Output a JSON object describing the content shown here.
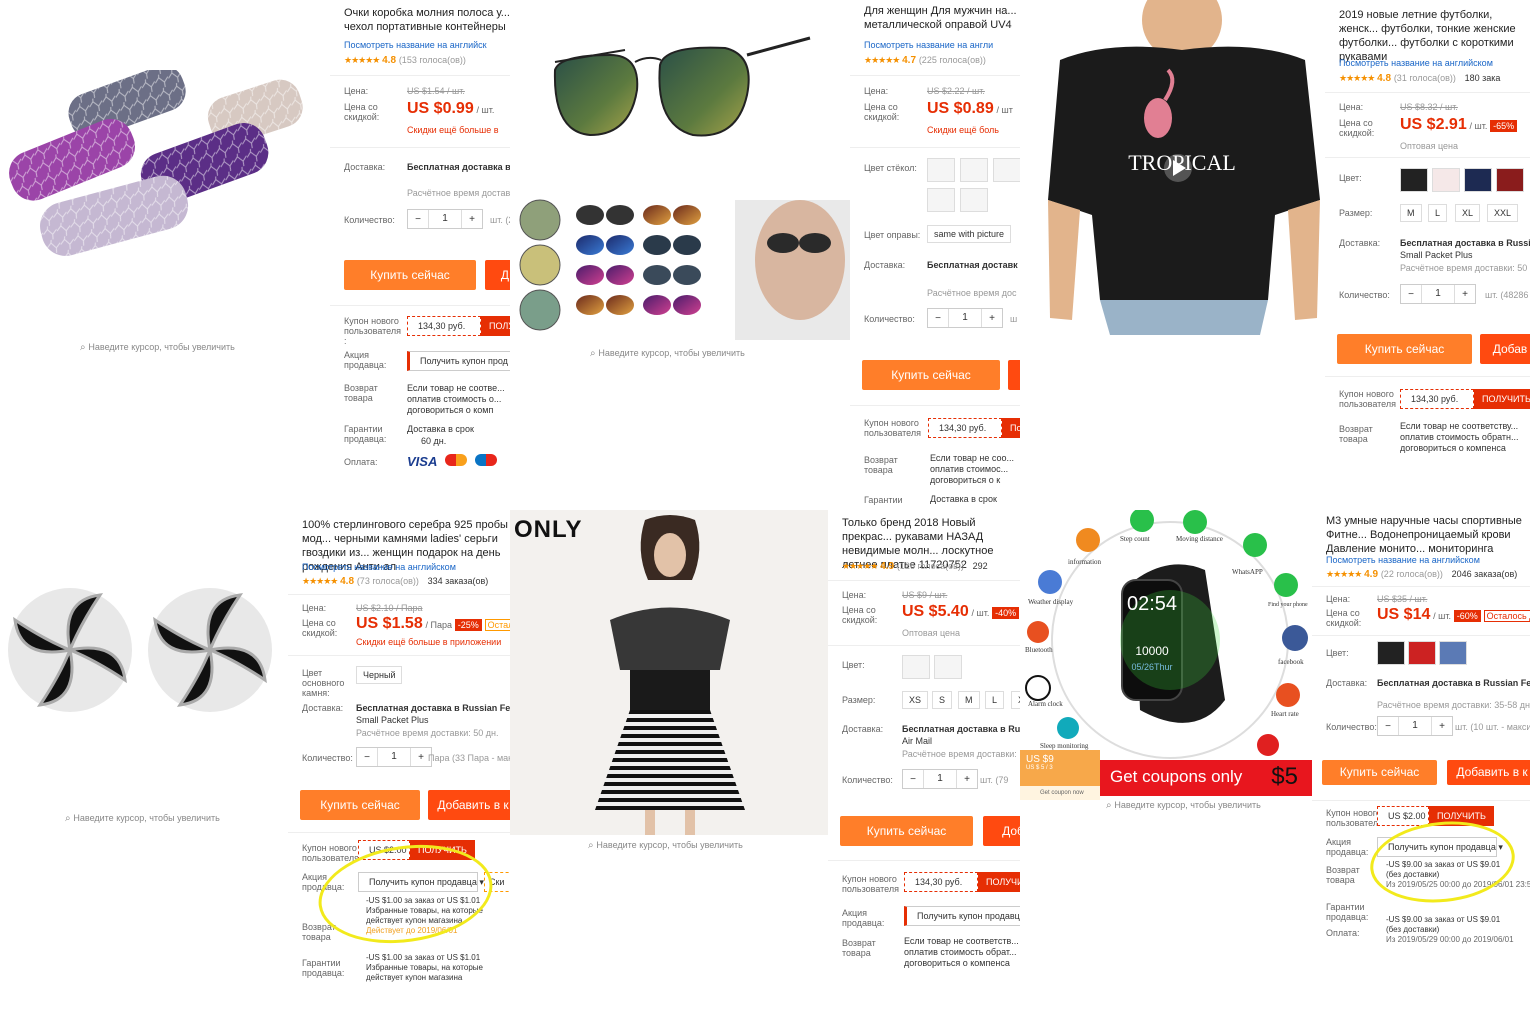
{
  "hint": "Наведите курсор, чтобы увеличить",
  "colors": {
    "accent": "#ff7e29",
    "price": "#e62e04",
    "link": "#1a66c7",
    "highlight": "#f2ea1c"
  },
  "p1": {
    "title": "Очки коробка молния полоса у... чехол портативные контейнеры",
    "translate": "Посмотреть название на английск",
    "stars": "★★★★★",
    "rating": "4.8",
    "reviews": "(153 голоса(ов))",
    "price_lbl": "Цена:",
    "old_price": "US $1.54 / шт.",
    "disc_lbl": "Цена со скидкой:",
    "price": "US $0.99",
    "unit": "/ шт.",
    "app_disc": "Скидки ещё больше в",
    "delivery_lbl": "Доставка:",
    "delivery": "Бесплатная доставка в",
    "delivery_time": "Расчётное время доставк",
    "qty_lbl": "Количество:",
    "qty": "1",
    "qty_unit": "шт. (2",
    "buy": "Купить сейчас",
    "add": "Д",
    "coupon_lbl": "Купон нового пользователя :",
    "coupon": "134,30 руб.",
    "coupon_get": "ПОЛУ",
    "promo_lbl": "Акция продавца:",
    "promo": "Получить купон прод",
    "return_lbl": "Возврат товара",
    "return": "Если товар не соотве... оплатив стоимость о... договориться о комп",
    "guarantee_lbl": "Гарантии продавца:",
    "guarantee": "Доставка в срок",
    "guarantee2": "60 дн.",
    "pay_lbl": "Оплата:",
    "pay_visa": "VISA"
  },
  "p2": {
    "title": "Для женщин Для мужчин на... металлической оправой UV4",
    "translate": "Посмотреть название на англи",
    "stars": "★★★★★",
    "rating": "4.7",
    "reviews": "(225 голоса(ов))",
    "price_lbl": "Цена:",
    "old_price": "US $2.22 / шт.",
    "disc_lbl": "Цена со скидкой:",
    "price": "US $0.89",
    "unit": "/ шт",
    "app_disc": "Скидки ещё боль",
    "lens_lbl": "Цвет стёкол:",
    "frame_lbl": "Цвет оправы:",
    "frame": "same with picture",
    "delivery_lbl": "Доставка:",
    "delivery": "Бесплатная доставк",
    "delivery_time": "Расчётное время дос",
    "qty_lbl": "Количество:",
    "qty": "1",
    "qty_unit": "ш",
    "buy": "Купить сейчас",
    "coupon_lbl": "Купон нового пользователя",
    "coupon": "134,30 руб.",
    "coupon_get": "По",
    "return_lbl": "Возврат товара",
    "return": "Если товар не соо... оплатив стоимос... договориться о к",
    "guarantee_lbl": "Гарантии",
    "guarantee": "Доставка в срок"
  },
  "p3": {
    "title": "2019 новые летние футболки, женск... футболки, тонкие женские футболки... футболки с короткими рукавами",
    "translate": "Посмотреть название на английском",
    "stars": "★★★★★",
    "rating": "4.8",
    "reviews": "(31 голоса(ов))",
    "orders": "180 зака",
    "price_lbl": "Цена:",
    "old_price": "US $8.32 / шт.",
    "disc_lbl": "Цена со скидкой:",
    "price": "US $2.91",
    "unit": "/ шт.",
    "disc": "-65%",
    "wholesale": "Оптовая цена",
    "color_lbl": "Цвет:",
    "size_lbl": "Размер:",
    "sizes": [
      "M",
      "L",
      "XL",
      "XXL"
    ],
    "delivery_lbl": "Доставка:",
    "delivery": "Бесплатная доставка в Russia",
    "delivery2": "Small Packet Plus",
    "delivery_time": "Расчётное время доставки: 50",
    "qty_lbl": "Количество:",
    "qty": "1",
    "qty_unit": "шт. (48286 и",
    "buy": "Купить сейчас",
    "add": "Добав",
    "coupon_lbl": "Купон нового пользователя",
    "coupon": "134,30 руб.",
    "coupon_get": "ПОЛУЧИТЬ",
    "return_lbl": "Возврат товара",
    "return": "Если товар не соответству... оплатив стоимость обратн... договориться о компенса",
    "shirt_text": "TROPICAL"
  },
  "p4": {
    "title": "100% стерлингового серебра 925 пробы мод... черными камнями ladies' серьги гвоздики из... женщин подарок на день рождения Анти-ал",
    "translate": "Посмотреть название на английском",
    "stars": "★★★★★",
    "rating": "4.8",
    "reviews": "(73 голоса(ов))",
    "orders": "334 заказа(ов)",
    "price_lbl": "Цена:",
    "old_price": "US $2.10 / Пара",
    "disc_lbl": "Цена со скидкой:",
    "price": "US $1.58",
    "unit": "/ Пара",
    "disc": "-25%",
    "left": "Остал",
    "app_disc": "Скидки ещё больше в приложении",
    "stone_lbl": "Цвет основного камня:",
    "stone": "Черный",
    "delivery_lbl": "Доставка:",
    "delivery": "Бесплатная доставка в Russian Federa",
    "delivery2": "Small Packet Plus",
    "delivery_time": "Расчётное время доставки: 50 дн.",
    "qty_lbl": "Количество:",
    "qty": "1",
    "qty_unit": "Пара (33 Пара - макс",
    "buy": "Купить сейчас",
    "add": "Добавить в к",
    "coupon_lbl": "Купон нового пользователя",
    "coupon": "US $2.00",
    "coupon_get": "ПОЛУЧИТЬ",
    "promo_lbl": "Акция продавца:",
    "promo": "Получить купон продавца ▾",
    "promo2": "Ски",
    "offer1": "-US $1.00 за заказ от US $1.01",
    "offer1b": "Избранные товары, на которые",
    "offer1c": "действует купон магазина",
    "offer1d": "Действует до 2019/06/01",
    "return_lbl": "Возврат товара",
    "guarantee_lbl": "Гарантии продавца:",
    "offer2": "-US $1.00 за заказ от US $1.01",
    "offer2b": "Избранные товары, на которые",
    "offer2c": "действует купон магазина"
  },
  "p5": {
    "brand": "ONLY",
    "title": "Только бренд 2018 Новый прекрас... рукавами НАЗАД невидимые молн... лоскутное летнее платье 11720752",
    "stars": "★★★★★",
    "rating": "4.9",
    "reviews": "(126 голоса(ов))",
    "orders": "292",
    "price_lbl": "Цена:",
    "old_price": "US $9 / шт.",
    "disc_lbl": "Цена со скидкой:",
    "price": "US $5.40",
    "unit": "/ шт.",
    "disc": "-40%",
    "wholesale": "Оптовая цена",
    "color_lbl": "Цвет:",
    "size_lbl": "Размер:",
    "sizes": [
      "XS",
      "S",
      "M",
      "L",
      "X"
    ],
    "delivery_lbl": "Доставка:",
    "delivery": "Бесплатная доставка в Rus",
    "delivery2": "Air Mail",
    "delivery_time": "Расчётное время доставки:",
    "qty_lbl": "Количество:",
    "qty": "1",
    "qty_unit": "шт. (79",
    "buy": "Купить сейчас",
    "add": "Доб",
    "coupon_lbl": "Купон нового пользователя",
    "coupon": "134,30 руб.",
    "coupon_get": "ПОЛУЧИ",
    "promo_lbl": "Акция продавца:",
    "promo": "Получить купон продавца",
    "return_lbl": "Возврат товара",
    "return": "Если товар не соответств... оплатив стоимость обрат... договориться о компенса"
  },
  "p6": {
    "title": "M3 умные наручные часы спортивные Фитне... Водонепроницаемый крови Давление монито... мониторинга",
    "translate": "Посмотреть название на английском",
    "stars": "★★★★★",
    "rating": "4.9",
    "reviews": "(22 голоса(ов))",
    "orders": "2046 заказа(ов)",
    "price_lbl": "Цена:",
    "old_price": "US $35 / шт.",
    "disc_lbl": "Цена со скидкой:",
    "price": "US $14",
    "unit": "/ шт.",
    "disc": "-60%",
    "left": "Осталось дней",
    "color_lbl": "Цвет:",
    "delivery_lbl": "Доставка:",
    "delivery": "Бесплатная доставка в Russian Federat",
    "delivery_time": "Расчётное время доставки: 35-58 дн.",
    "qty_lbl": "Количество:",
    "qty": "1",
    "qty_unit": "шт. (10 шт. - максимум",
    "buy": "Купить сейчас",
    "add": "Добавить в к",
    "coupon_lbl": "Купон нового пользователя",
    "coupon": "US $2.00",
    "coupon_get": "ПОЛУЧИТЬ",
    "promo_lbl": "Акция продавца:",
    "promo": "Получить купон продавца ▾",
    "return_lbl": "Возврат товара",
    "guarantee_lbl": "Гарантии продавца:",
    "pay_lbl": "Оплата:",
    "offer1": "-US $9.00 за заказ от US $9.01",
    "offer1b": "(без доставки)",
    "offer1c": "Из 2019/05/25 00:00 до 2019/06/01",
    "offer1d": "23:5",
    "offer2": "-US $9.00 за заказ от US $9.01",
    "offer2b": "(без доставки)",
    "offer2c": "Из 2019/05/29 00:00 до 2019/06/01",
    "banner": "Get coupons only",
    "banner_price": "$5",
    "mini_price": "US $9",
    "mini_sub": "US $ 5 / 3",
    "mini_coupon": "Get coupon now",
    "watch_time": "02:54",
    "watch_steps": "10000",
    "watch_date": "05/26Thur",
    "features": [
      "Step count",
      "Moving distance",
      "information",
      "WhatsAPP",
      "Weather display",
      "Find your phone",
      "facebook",
      "Bluetooth",
      "Alarm clock",
      "Heart rate",
      "Sleep monitoring"
    ]
  }
}
